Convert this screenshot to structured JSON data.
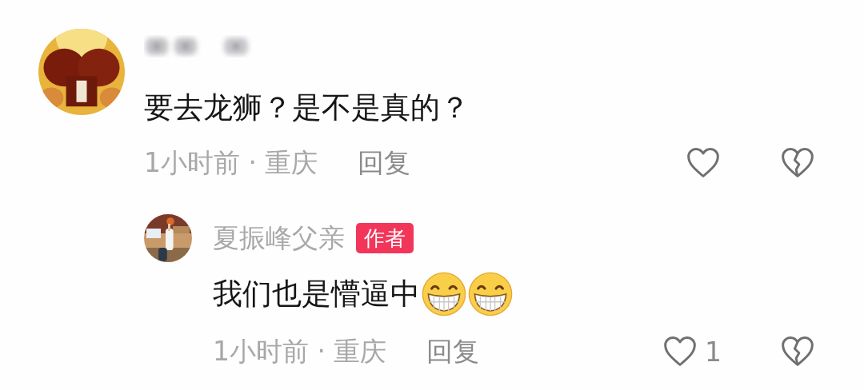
{
  "comments": [
    {
      "author_blurred": true,
      "content": [
        {
          "kind": "text",
          "text": "要去龙狮？是不是真的？"
        }
      ],
      "time_location": "1小时前 · 重庆",
      "reply_label": "回复",
      "replies": [
        {
          "author": "夏振峰父亲",
          "badge": "作者",
          "content": [
            {
              "kind": "text",
              "text": "我们也是懵逼中"
            },
            {
              "kind": "emoji"
            },
            {
              "kind": "emoji"
            }
          ],
          "time_location": "1小时前 · 重庆",
          "reply_label": "回复",
          "like_count": "1"
        }
      ]
    }
  ]
}
